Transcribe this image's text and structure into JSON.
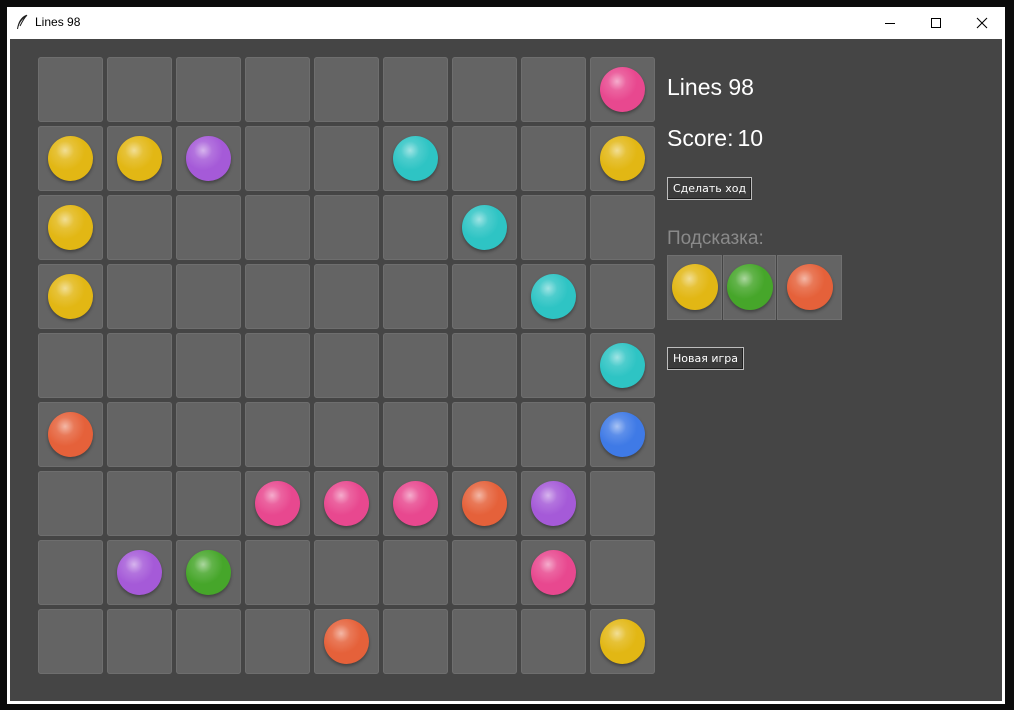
{
  "window": {
    "title": "Lines 98",
    "icon": "feather-icon",
    "controls": [
      "minimize-icon",
      "maximize-icon",
      "close-icon"
    ]
  },
  "colors": {
    "yellow": "#e2b714",
    "pink": "#e8488f",
    "purple": "#a55ad8",
    "cyan": "#2ec4c4",
    "orange": "#e5613a",
    "blue": "#3f7ae6",
    "green": "#46a62a",
    "cell": "#646464",
    "background": "#454545"
  },
  "board": {
    "size": 9,
    "rows": [
      [
        null,
        null,
        null,
        null,
        null,
        null,
        null,
        null,
        "pink"
      ],
      [
        "yellow",
        "yellow",
        "purple",
        null,
        null,
        "cyan",
        null,
        null,
        "yellow"
      ],
      [
        "yellow",
        null,
        null,
        null,
        null,
        null,
        "cyan",
        null,
        null
      ],
      [
        "yellow",
        null,
        null,
        null,
        null,
        null,
        null,
        "cyan",
        null
      ],
      [
        null,
        null,
        null,
        null,
        null,
        null,
        null,
        null,
        "cyan"
      ],
      [
        "orange",
        null,
        null,
        null,
        null,
        null,
        null,
        null,
        "blue"
      ],
      [
        null,
        null,
        null,
        "pink",
        "pink",
        "pink",
        "orange",
        "purple",
        null
      ],
      [
        null,
        "purple",
        "green",
        null,
        null,
        null,
        null,
        "pink",
        null
      ],
      [
        null,
        null,
        null,
        null,
        "orange",
        null,
        null,
        null,
        "yellow"
      ]
    ]
  },
  "panel": {
    "title": "Lines 98",
    "score_label": "Score:",
    "score_value": "10",
    "make_move_label": "Сделать ход",
    "hint_label": "Подсказка:",
    "hint_balls": [
      "yellow",
      "green",
      "orange"
    ],
    "new_game_label": "Новая игра"
  }
}
